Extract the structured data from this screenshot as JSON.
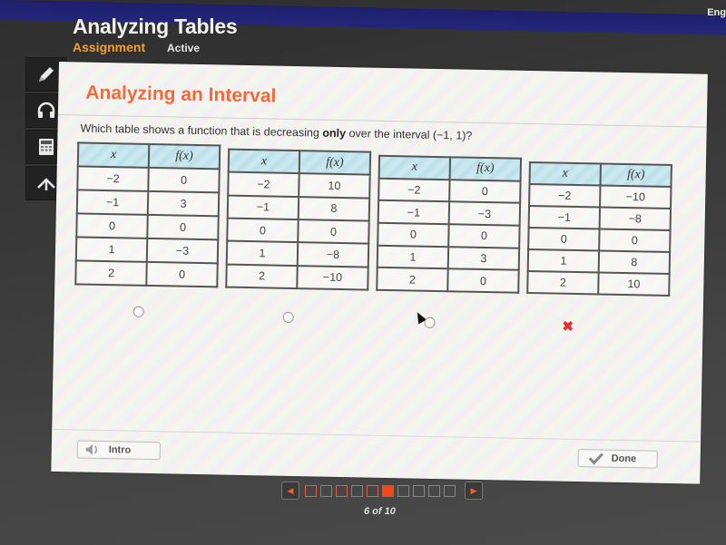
{
  "system": {
    "language_label": "Eng"
  },
  "app": {
    "title": "Analyzing Tables",
    "type_label": "Assignment",
    "status_label": "Active"
  },
  "toolbar": {
    "tools": [
      {
        "name": "pencil-icon",
        "label": "Pencil"
      },
      {
        "name": "headphones-icon",
        "label": "Audio"
      },
      {
        "name": "calculator-icon",
        "label": "Calculator"
      },
      {
        "name": "arrow-up-icon",
        "label": "Collapse"
      }
    ]
  },
  "lesson": {
    "title": "Analyzing an Interval",
    "question_pre": "Which table shows a function that is decreasing ",
    "question_bold": "only",
    "question_post": " over the interval (−1, 1)?"
  },
  "tables": [
    {
      "header": [
        "x",
        "f(x)"
      ],
      "rows": [
        [
          "−2",
          "0"
        ],
        [
          "−1",
          "3"
        ],
        [
          "0",
          "0"
        ],
        [
          "1",
          "−3"
        ],
        [
          "2",
          "0"
        ]
      ]
    },
    {
      "header": [
        "x",
        "f(x)"
      ],
      "rows": [
        [
          "−2",
          "10"
        ],
        [
          "−1",
          "8"
        ],
        [
          "0",
          "0"
        ],
        [
          "1",
          "−8"
        ],
        [
          "2",
          "−10"
        ]
      ]
    },
    {
      "header": [
        "x",
        "f(x)"
      ],
      "rows": [
        [
          "−2",
          "0"
        ],
        [
          "−1",
          "−3"
        ],
        [
          "0",
          "0"
        ],
        [
          "1",
          "3"
        ],
        [
          "2",
          "0"
        ]
      ]
    },
    {
      "header": [
        "x",
        "f(x)"
      ],
      "rows": [
        [
          "−2",
          "−10"
        ],
        [
          "−1",
          "−8"
        ],
        [
          "0",
          "0"
        ],
        [
          "1",
          "8"
        ],
        [
          "2",
          "10"
        ]
      ]
    }
  ],
  "answers": {
    "options": [
      {
        "label": "option-1",
        "selected": false
      },
      {
        "label": "option-2",
        "selected": false
      },
      {
        "label": "option-3",
        "selected": false
      },
      {
        "label": "option-4",
        "selected": true,
        "result": "incorrect",
        "result_glyph": "✖"
      }
    ]
  },
  "buttons": {
    "intro_label": "Intro",
    "done_label": "Done"
  },
  "pager": {
    "current": 6,
    "total": 10,
    "label": "6 of 10",
    "prev_glyph": "◀",
    "next_glyph": "▶"
  },
  "colors": {
    "accent": "#f06a3a",
    "assignment": "#f0a030",
    "current_page": "#f04a1a",
    "incorrect": "#e03030"
  }
}
